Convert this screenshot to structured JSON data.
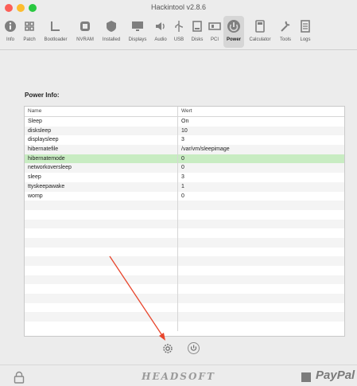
{
  "window": {
    "title": "Hackintool v2.8.6"
  },
  "toolbar": {
    "items": [
      {
        "label": "Info",
        "icon": "info-icon"
      },
      {
        "label": "Patch",
        "icon": "patch-icon"
      },
      {
        "label": "Bootloader",
        "icon": "bootloader-icon"
      },
      {
        "label": "NVRAM",
        "icon": "nvram-icon"
      },
      {
        "label": "Installed",
        "icon": "installed-icon"
      },
      {
        "label": "Displays",
        "icon": "displays-icon"
      },
      {
        "label": "Audio",
        "icon": "audio-icon"
      },
      {
        "label": "USB",
        "icon": "usb-icon"
      },
      {
        "label": "Disks",
        "icon": "disks-icon"
      },
      {
        "label": "PCI",
        "icon": "pci-icon"
      },
      {
        "label": "Power",
        "icon": "power-icon"
      },
      {
        "label": "Calculator",
        "icon": "calculator-icon"
      },
      {
        "label": "Tools",
        "icon": "tools-icon"
      },
      {
        "label": "Logs",
        "icon": "logs-icon"
      }
    ],
    "active": "Power"
  },
  "power": {
    "section_title": "Power Info:",
    "columns": [
      "Name",
      "Wert"
    ],
    "rows": [
      {
        "name": "Sleep",
        "value": "On"
      },
      {
        "name": "disksleep",
        "value": "10"
      },
      {
        "name": "displaysleep",
        "value": "3"
      },
      {
        "name": "hibernatefile",
        "value": "/var/vm/sleepimage"
      },
      {
        "name": "hibernatemode",
        "value": "0"
      },
      {
        "name": "networkoversleep",
        "value": "0"
      },
      {
        "name": "sleep",
        "value": "3"
      },
      {
        "name": "ttyskeepawake",
        "value": "1"
      },
      {
        "name": "womp",
        "value": "0"
      }
    ],
    "selected_row": "hibernatemode"
  },
  "footer": {
    "logo": "HEADSOFT",
    "paypal": "PayPal"
  },
  "colors": {
    "selected_row": "#c8ecc2",
    "annotation_arrow": "#e8452c"
  }
}
